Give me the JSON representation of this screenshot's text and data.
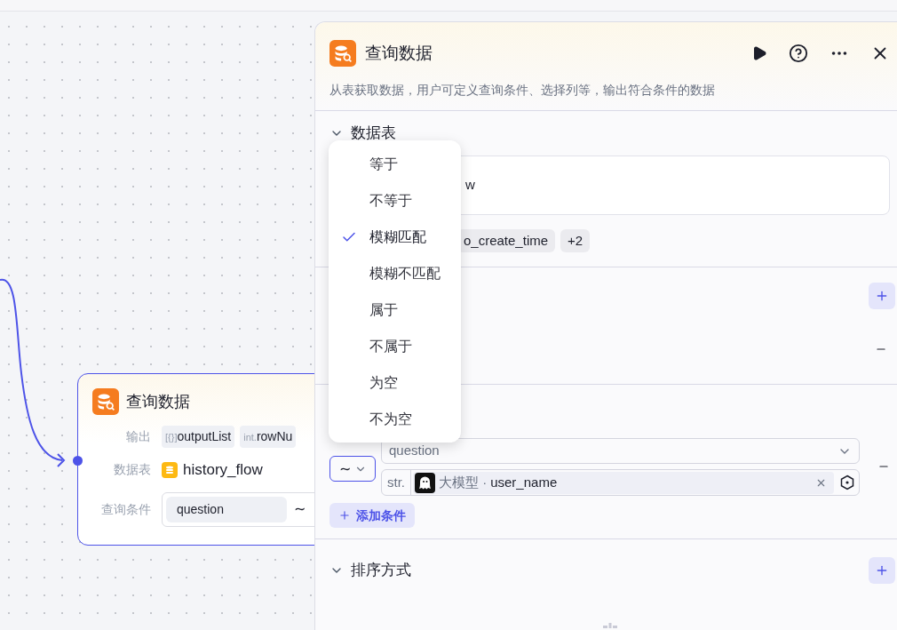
{
  "node": {
    "title": "查询数据",
    "output_label": "输出",
    "outputs": [
      {
        "type": "[{}]",
        "name": "outputList"
      },
      {
        "type": "int.",
        "name": "rowNu"
      }
    ],
    "table_label": "数据表",
    "table": "history_flow",
    "condition_label": "查询条件",
    "condition_field": "question",
    "condition_op": "∼"
  },
  "panel": {
    "title": "查询数据",
    "description": "从表获取数据，用户可定义查询条件、选择列等，输出符合条件的数据"
  },
  "table_section": {
    "title": "数据表",
    "expanded": true,
    "value": "w",
    "tags": [
      "o_create_time",
      "+2"
    ]
  },
  "condition": {
    "op": "∼",
    "field": "question",
    "value_type": "str.",
    "value_source": "大模型 ·",
    "value_name": "user_name",
    "add_label": "添加条件"
  },
  "sort_section": {
    "title": "排序方式",
    "expanded": true
  },
  "dropdown": [
    {
      "label": "等于",
      "selected": false
    },
    {
      "label": "不等于",
      "selected": false
    },
    {
      "label": "模糊匹配",
      "selected": true
    },
    {
      "label": "模糊不匹配",
      "selected": false
    },
    {
      "label": "属于",
      "selected": false
    },
    {
      "label": "不属于",
      "selected": false
    },
    {
      "label": "为空",
      "selected": false
    },
    {
      "label": "不为空",
      "selected": false
    }
  ]
}
